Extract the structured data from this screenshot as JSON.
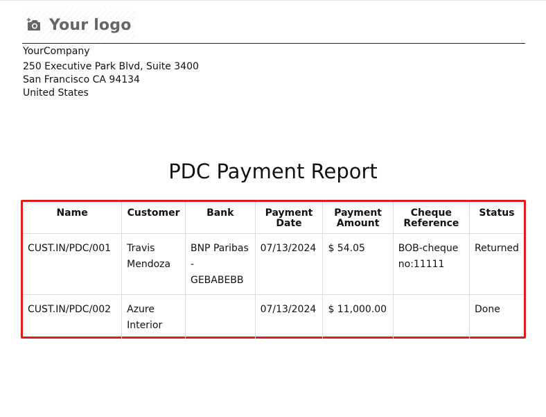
{
  "logo": {
    "icon": "camera-icon",
    "text": "Your logo"
  },
  "company": {
    "name": "YourCompany",
    "address_line1": "250 Executive Park Blvd, Suite 3400",
    "address_line2": "San Francisco CA 94134",
    "country": "United States"
  },
  "report": {
    "title": "PDC Payment Report",
    "highlight_color": "#e01b1b",
    "columns": [
      "Name",
      "Customer",
      "Bank",
      "Payment Date",
      "Payment Amount",
      "Cheque Reference",
      "Status"
    ],
    "rows": [
      {
        "name": "CUST.IN/PDC/001",
        "customer": "Travis Mendoza",
        "bank": "BNP Paribas - GEBABEBB",
        "payment_date": "07/13/2024",
        "payment_amount": "$ 54.05",
        "cheque_reference": "BOB-cheque no:11111",
        "status": "Returned"
      },
      {
        "name": "CUST.IN/PDC/002",
        "customer": "Azure Interior",
        "bank": "",
        "payment_date": "07/13/2024",
        "payment_amount": "$ 11,000.00",
        "cheque_reference": "",
        "status": "Done"
      }
    ]
  }
}
